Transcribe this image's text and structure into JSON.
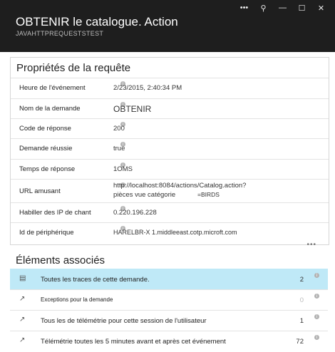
{
  "header": {
    "title": "OBTENIR le catalogue. Action",
    "subtitle": "JAVAHTTPREQUESTSTEST",
    "controls": [
      "•••",
      "⚲",
      "—",
      "☐",
      "✕"
    ]
  },
  "properties": {
    "title": "Propriétés de la requête",
    "rows": [
      {
        "label": "Heure de l'événement",
        "value": "2/23/2015, 2:40:34 PM"
      },
      {
        "label": "Nom de la demande",
        "value": "OBTENIR"
      },
      {
        "label": "Code de réponse",
        "value": "200"
      },
      {
        "label": "Demande réussie",
        "value": "true"
      },
      {
        "label": "Temps de réponse",
        "value": "1OMS"
      },
      {
        "label": "URL amusant",
        "value": "http://localhost:8084/actions/Catalog.action?",
        "value2": "pièces vue catégorie",
        "value3": "=BIRDS"
      },
      {
        "label": "Habiller des IP de chant",
        "value": "0.220.196.228"
      },
      {
        "label": "Id de périphérique",
        "value": "HARELBR-X 1.middleeast.cotp.microft.com"
      }
    ],
    "more": "•••"
  },
  "related": {
    "title": "Éléments associés",
    "items": [
      {
        "label": "Toutes les traces de cette demande.",
        "count": "2",
        "icon": "document-icon"
      },
      {
        "label": "Exceptions pour la demande",
        "count": "0",
        "icon": "arrow-icon"
      },
      {
        "label": "Tous les de télémétrie pour cette session de l'utilisateur",
        "count": "1",
        "icon": "arrow-icon"
      },
      {
        "label": "Télémétrie toutes les 5 minutes avant et après cet événement",
        "count": "72",
        "icon": "arrow-icon"
      }
    ]
  },
  "info_glyph": "i"
}
